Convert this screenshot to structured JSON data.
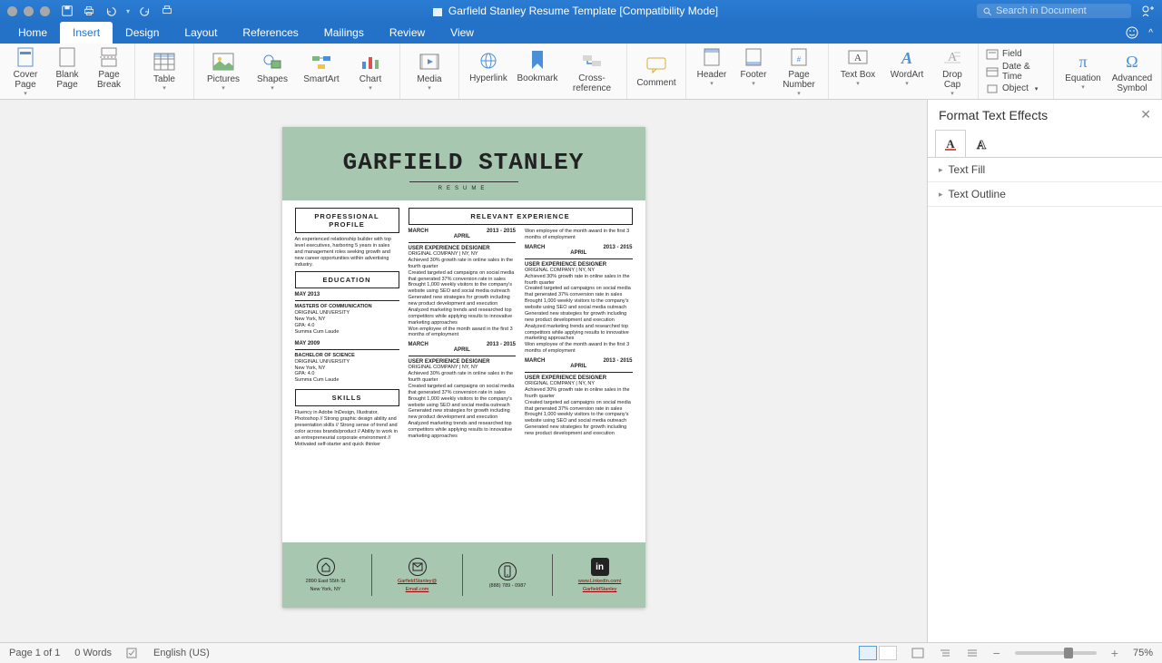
{
  "title": "Garfield Stanley Resume Template [Compatibility Mode]",
  "search_placeholder": "Search in Document",
  "tabs": [
    "Home",
    "Insert",
    "Design",
    "Layout",
    "References",
    "Mailings",
    "Review",
    "View"
  ],
  "active_tab": "Insert",
  "ribbon": {
    "cover_page": "Cover Page",
    "blank_page": "Blank Page",
    "page_break": "Page Break",
    "table": "Table",
    "pictures": "Pictures",
    "shapes": "Shapes",
    "smartart": "SmartArt",
    "chart": "Chart",
    "media": "Media",
    "hyperlink": "Hyperlink",
    "bookmark": "Bookmark",
    "cross_reference": "Cross-reference",
    "comment": "Comment",
    "header": "Header",
    "footer": "Footer",
    "page_number": "Page Number",
    "text_box": "Text Box",
    "wordart": "WordArt",
    "drop_cap": "Drop Cap",
    "field": "Field",
    "date_time": "Date & Time",
    "object": "Object",
    "equation": "Equation",
    "advanced_symbol": "Advanced Symbol"
  },
  "doc": {
    "name": "GARFIELD STANLEY",
    "subtitle": "RESUME",
    "profile_hdr1": "PROFESSIONAL",
    "profile_hdr2": "PROFILE",
    "profile_body": "An experienced relationship builder with top level executives, harboring 5 years in sales and management roles seeking growth and new career opportunities within advertising industry.",
    "education_hdr": "EDUCATION",
    "edu1_date": "MAY 2013",
    "edu1_deg": "MASTERS OF COMMUNICATION",
    "edu1_school": "ORIGINAL UNIVERSITY",
    "edu1_city": "New York, NY",
    "edu1_gpa": "GPA: 4.0",
    "edu1_honor": "Summa Cum Laude",
    "edu2_date": "MAY 2009",
    "edu2_deg": "BACHELOR OF SCIENCE",
    "skills_hdr": "SKILLS",
    "skills_body": "Fluency in Adobe InDesign, Illustrator, Photoshop // Strong graphic design ability and presentation skills // Strong sense of trend and color across brands/product // Ability to work in an entrepreneurial corporate environment // Motivated self-starter and quick thinker",
    "exp_hdr": "RELEVANT EXPERIENCE",
    "d_left": "MARCH",
    "d_right": "2013 - 2015",
    "d_sub": "APRIL",
    "job_title": "USER EXPERIENCE DESIGNER",
    "job_company": "ORIGINAL COMPANY | NY, NY",
    "bullet1": "Achieved 30% growth rate in online sales in the fourth quarter",
    "bullet2": "Created targeted ad campaigns on social media that generated 37% conversion rate in sales",
    "bullet3": "Brought 1,000 weekly visitors to the company's website using SEO and social media outreach",
    "bullet4": "Generated new strategies for growth including new product development and execution",
    "bullet5": "Analyzed marketing trends and researched top competitors while applying results to innovative marketing approaches",
    "bullet6": "Won employee of the month award in the first 3 months of employment",
    "contact_addr1": "2890 East 55th St",
    "contact_addr2": "New York, NY",
    "contact_email1": "GarfieldStanley@",
    "contact_email2": "Email.com",
    "contact_phone": "(888) 789 - 0987",
    "contact_linkedin1": "www.LinkedIn.com/",
    "contact_linkedin2": "GarfieldStanley"
  },
  "pane": {
    "title": "Format Text Effects",
    "fill": "Text Fill",
    "outline": "Text Outline"
  },
  "status": {
    "page": "Page 1 of 1",
    "words": "0 Words",
    "lang": "English (US)",
    "zoom": "75%"
  }
}
